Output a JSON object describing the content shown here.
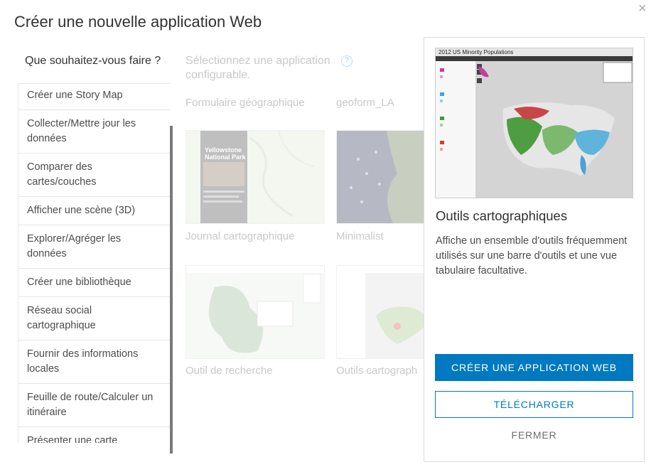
{
  "dialog": {
    "title": "Créer une nouvelle application Web",
    "close_glyph": "×"
  },
  "left": {
    "heading": "Que souhaitez-vous faire ?",
    "items": [
      {
        "label": "Créer une Story Map"
      },
      {
        "label": "Collecter/Mettre jour les données"
      },
      {
        "label": "Comparer des cartes/couches"
      },
      {
        "label": "Afficher une scène (3D)"
      },
      {
        "label": "Explorer/Agréger les données"
      },
      {
        "label": "Créer une bibliothèque"
      },
      {
        "label": "Réseau social cartographique"
      },
      {
        "label": "Fournir des informations locales"
      },
      {
        "label": "Feuille de route/Calculer un itinéraire"
      },
      {
        "label": "Présenter une carte"
      }
    ]
  },
  "middle": {
    "heading": "Sélectionnez une application configurable.",
    "help_glyph": "?",
    "apps": [
      {
        "label": "Formulaire géographique"
      },
      {
        "label": "geoform_LA"
      },
      {
        "label": "Journal cartographique",
        "thumb_title": "Yellowstone National Park"
      },
      {
        "label": "Minimalist"
      },
      {
        "label": "Outil de recherche"
      },
      {
        "label": "Outils cartograph"
      }
    ]
  },
  "panel": {
    "preview_title": "2012 US Minority Populations",
    "title": "Outils cartographiques",
    "description": "Affiche un ensemble d'outils fréquemment utilisés sur une barre d'outils et une vue tabulaire facultative.",
    "create_button": "CRÉER UNE APPLICATION WEB",
    "download_button": "TÉLÉCHARGER",
    "close_button": "FERMER"
  },
  "colors": {
    "accent": "#0079c1",
    "help": "#2e8bd3"
  }
}
